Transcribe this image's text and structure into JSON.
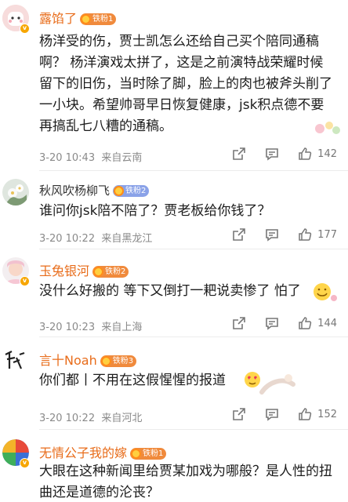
{
  "comments": [
    {
      "username": "露馅了",
      "name_color": "#e86c1a",
      "fan_level": "铁粉1",
      "fan_color": "#f08a3c",
      "text": "杨洋受的伤，贾士凯怎么还给自己买个陪同通稿啊？ 杨洋演戏太拼了，这是之前演特战荣耀时候留下的旧伤，当时除了脚，脸上的肉也被斧头削了一小块。希望帅哥早日恢复健康，jsk积点德不要再搞乱七八糟的通稿。",
      "time": "3-20 10:43",
      "location": "来自云南",
      "likes": "142",
      "share_icon": "share-icon",
      "comment_icon": "comment-icon",
      "like_icon": "thumbs-up-icon"
    },
    {
      "username": "秋风吹杨柳飞",
      "name_color": "#333333",
      "fan_level": "铁粉2",
      "fan_color": "#8aa2e8",
      "text": "谁问你jsk陪不陪了？贾老板给你钱了？",
      "time": "3-20 10:22",
      "location": "来自黑龙江",
      "likes": "177"
    },
    {
      "username": "玉兔银河",
      "name_color": "#e86c1a",
      "fan_level": "铁粉2",
      "fan_color": "#f08a3c",
      "text": "没什么好搬的 等下又倒打一耙说卖惨了 怕了",
      "time": "3-20 10:23",
      "location": "来自上海",
      "likes": "144"
    },
    {
      "username": "言十Noah",
      "name_color": "#e86c1a",
      "fan_level": "铁粉3",
      "fan_color": "#f08a3c",
      "text": "你们都丨不用在这假惺惺的报道",
      "time": "3-20 10:22",
      "location": "来自河北",
      "likes": "152"
    },
    {
      "username": "无情公子我的嫁",
      "name_color": "#e86c1a",
      "fan_level": "铁粉1",
      "fan_color": "#f08a3c",
      "text": "大眼在这种新闻里给贾某加戏为哪般？是人性的扭曲还是道德的沦丧？",
      "time": "",
      "location": "",
      "likes": ""
    }
  ],
  "colors": {
    "meta_gray": "#8a8a8a",
    "divider": "#ececec",
    "vip_badge": "#f7a600"
  }
}
